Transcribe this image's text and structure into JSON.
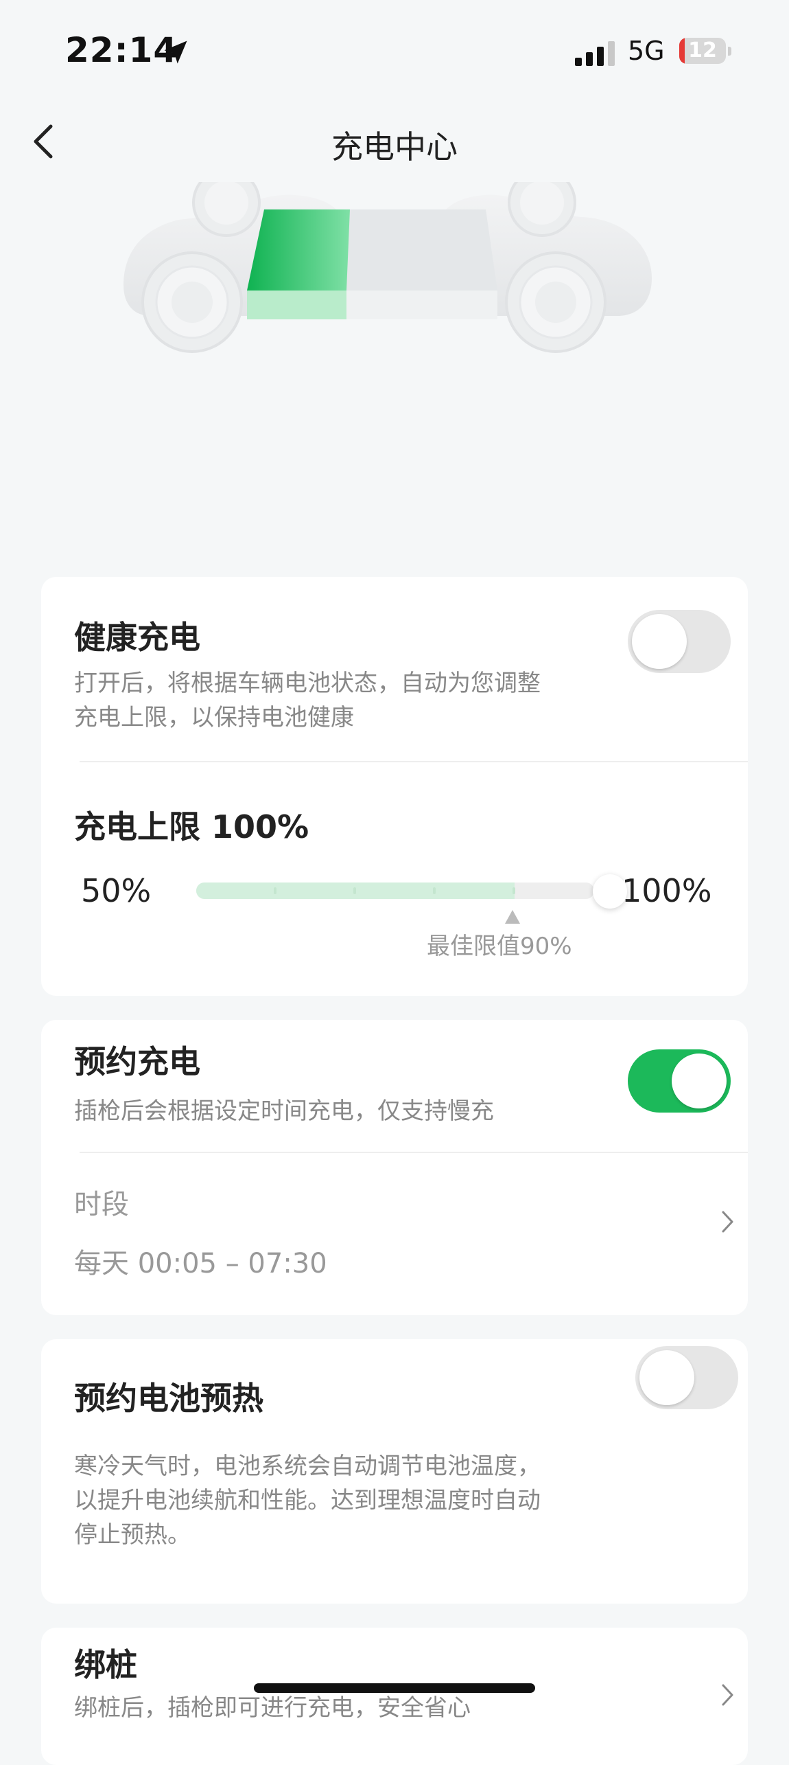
{
  "status_bar": {
    "time": "22:14",
    "network": "5G",
    "battery_level": "12",
    "battery_fill": 0.12,
    "battery_color": "#e53935",
    "icons": [
      "location-arrow-icon",
      "signal-bars-icon",
      "battery-icon"
    ]
  },
  "nav": {
    "title": "充电中心",
    "back_icon": "chevron-left-icon"
  },
  "car_graphic": {
    "battery_fill": 0.19,
    "accent": "#1cb95a"
  },
  "healthy_charging": {
    "title": "健康充电",
    "description_lines": [
      "打开后，将根据车辆电池状态，自动为您调整",
      "充电上限，以保持电池健康"
    ],
    "enabled": false
  },
  "charge_limit": {
    "title": "充电上限 100%",
    "min_label": "50%",
    "max_label": "100%",
    "value_percent": 100,
    "recommended_percent": 90,
    "recommended_label": "最佳限值90%"
  },
  "scheduled_charging": {
    "title": "预约充电",
    "description": "插枪后会根据设定时间充电，仅支持慢充",
    "enabled": true,
    "period_label": "时段",
    "period_value": "每天 00:05 – 07:30"
  },
  "battery_preheat": {
    "title": "预约电池预热",
    "description_lines": [
      "寒冷天气时，电池系统会自动调节电池温度，",
      "以提升电池续航和性能。达到理想温度时自动",
      "停止预热。"
    ],
    "enabled": false
  },
  "bind_pile": {
    "title": "绑桩",
    "description": "绑桩后，插枪即可进行充电，安全省心"
  },
  "colors": {
    "accent_green": "#1cb95a",
    "background": "#f5f7f8"
  }
}
